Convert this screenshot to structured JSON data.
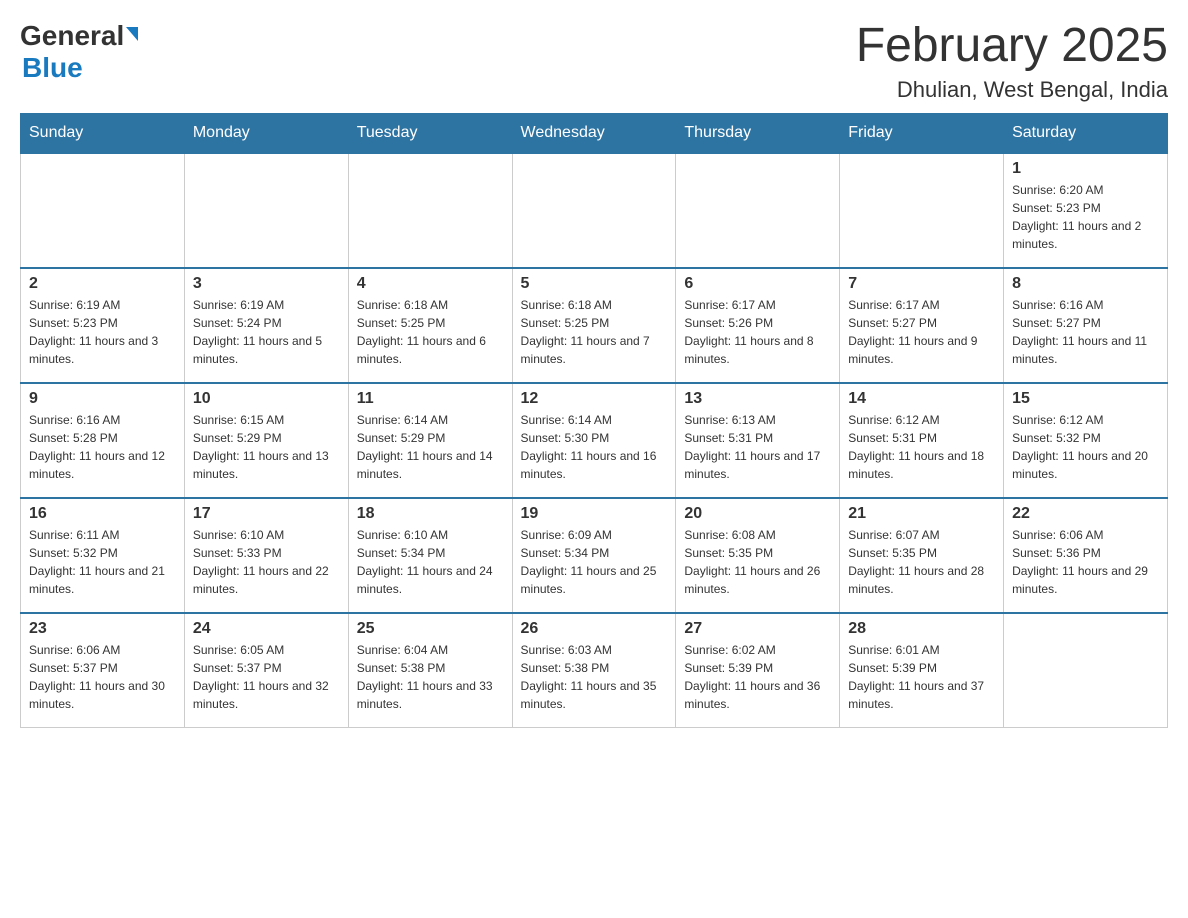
{
  "header": {
    "logo": {
      "general_text": "General",
      "blue_text": "Blue"
    },
    "title": "February 2025",
    "subtitle": "Dhulian, West Bengal, India"
  },
  "days_of_week": [
    "Sunday",
    "Monday",
    "Tuesday",
    "Wednesday",
    "Thursday",
    "Friday",
    "Saturday"
  ],
  "weeks": [
    [
      {
        "day": "",
        "sunrise": "",
        "sunset": "",
        "daylight": ""
      },
      {
        "day": "",
        "sunrise": "",
        "sunset": "",
        "daylight": ""
      },
      {
        "day": "",
        "sunrise": "",
        "sunset": "",
        "daylight": ""
      },
      {
        "day": "",
        "sunrise": "",
        "sunset": "",
        "daylight": ""
      },
      {
        "day": "",
        "sunrise": "",
        "sunset": "",
        "daylight": ""
      },
      {
        "day": "",
        "sunrise": "",
        "sunset": "",
        "daylight": ""
      },
      {
        "day": "1",
        "sunrise": "Sunrise: 6:20 AM",
        "sunset": "Sunset: 5:23 PM",
        "daylight": "Daylight: 11 hours and 2 minutes."
      }
    ],
    [
      {
        "day": "2",
        "sunrise": "Sunrise: 6:19 AM",
        "sunset": "Sunset: 5:23 PM",
        "daylight": "Daylight: 11 hours and 3 minutes."
      },
      {
        "day": "3",
        "sunrise": "Sunrise: 6:19 AM",
        "sunset": "Sunset: 5:24 PM",
        "daylight": "Daylight: 11 hours and 5 minutes."
      },
      {
        "day": "4",
        "sunrise": "Sunrise: 6:18 AM",
        "sunset": "Sunset: 5:25 PM",
        "daylight": "Daylight: 11 hours and 6 minutes."
      },
      {
        "day": "5",
        "sunrise": "Sunrise: 6:18 AM",
        "sunset": "Sunset: 5:25 PM",
        "daylight": "Daylight: 11 hours and 7 minutes."
      },
      {
        "day": "6",
        "sunrise": "Sunrise: 6:17 AM",
        "sunset": "Sunset: 5:26 PM",
        "daylight": "Daylight: 11 hours and 8 minutes."
      },
      {
        "day": "7",
        "sunrise": "Sunrise: 6:17 AM",
        "sunset": "Sunset: 5:27 PM",
        "daylight": "Daylight: 11 hours and 9 minutes."
      },
      {
        "day": "8",
        "sunrise": "Sunrise: 6:16 AM",
        "sunset": "Sunset: 5:27 PM",
        "daylight": "Daylight: 11 hours and 11 minutes."
      }
    ],
    [
      {
        "day": "9",
        "sunrise": "Sunrise: 6:16 AM",
        "sunset": "Sunset: 5:28 PM",
        "daylight": "Daylight: 11 hours and 12 minutes."
      },
      {
        "day": "10",
        "sunrise": "Sunrise: 6:15 AM",
        "sunset": "Sunset: 5:29 PM",
        "daylight": "Daylight: 11 hours and 13 minutes."
      },
      {
        "day": "11",
        "sunrise": "Sunrise: 6:14 AM",
        "sunset": "Sunset: 5:29 PM",
        "daylight": "Daylight: 11 hours and 14 minutes."
      },
      {
        "day": "12",
        "sunrise": "Sunrise: 6:14 AM",
        "sunset": "Sunset: 5:30 PM",
        "daylight": "Daylight: 11 hours and 16 minutes."
      },
      {
        "day": "13",
        "sunrise": "Sunrise: 6:13 AM",
        "sunset": "Sunset: 5:31 PM",
        "daylight": "Daylight: 11 hours and 17 minutes."
      },
      {
        "day": "14",
        "sunrise": "Sunrise: 6:12 AM",
        "sunset": "Sunset: 5:31 PM",
        "daylight": "Daylight: 11 hours and 18 minutes."
      },
      {
        "day": "15",
        "sunrise": "Sunrise: 6:12 AM",
        "sunset": "Sunset: 5:32 PM",
        "daylight": "Daylight: 11 hours and 20 minutes."
      }
    ],
    [
      {
        "day": "16",
        "sunrise": "Sunrise: 6:11 AM",
        "sunset": "Sunset: 5:32 PM",
        "daylight": "Daylight: 11 hours and 21 minutes."
      },
      {
        "day": "17",
        "sunrise": "Sunrise: 6:10 AM",
        "sunset": "Sunset: 5:33 PM",
        "daylight": "Daylight: 11 hours and 22 minutes."
      },
      {
        "day": "18",
        "sunrise": "Sunrise: 6:10 AM",
        "sunset": "Sunset: 5:34 PM",
        "daylight": "Daylight: 11 hours and 24 minutes."
      },
      {
        "day": "19",
        "sunrise": "Sunrise: 6:09 AM",
        "sunset": "Sunset: 5:34 PM",
        "daylight": "Daylight: 11 hours and 25 minutes."
      },
      {
        "day": "20",
        "sunrise": "Sunrise: 6:08 AM",
        "sunset": "Sunset: 5:35 PM",
        "daylight": "Daylight: 11 hours and 26 minutes."
      },
      {
        "day": "21",
        "sunrise": "Sunrise: 6:07 AM",
        "sunset": "Sunset: 5:35 PM",
        "daylight": "Daylight: 11 hours and 28 minutes."
      },
      {
        "day": "22",
        "sunrise": "Sunrise: 6:06 AM",
        "sunset": "Sunset: 5:36 PM",
        "daylight": "Daylight: 11 hours and 29 minutes."
      }
    ],
    [
      {
        "day": "23",
        "sunrise": "Sunrise: 6:06 AM",
        "sunset": "Sunset: 5:37 PM",
        "daylight": "Daylight: 11 hours and 30 minutes."
      },
      {
        "day": "24",
        "sunrise": "Sunrise: 6:05 AM",
        "sunset": "Sunset: 5:37 PM",
        "daylight": "Daylight: 11 hours and 32 minutes."
      },
      {
        "day": "25",
        "sunrise": "Sunrise: 6:04 AM",
        "sunset": "Sunset: 5:38 PM",
        "daylight": "Daylight: 11 hours and 33 minutes."
      },
      {
        "day": "26",
        "sunrise": "Sunrise: 6:03 AM",
        "sunset": "Sunset: 5:38 PM",
        "daylight": "Daylight: 11 hours and 35 minutes."
      },
      {
        "day": "27",
        "sunrise": "Sunrise: 6:02 AM",
        "sunset": "Sunset: 5:39 PM",
        "daylight": "Daylight: 11 hours and 36 minutes."
      },
      {
        "day": "28",
        "sunrise": "Sunrise: 6:01 AM",
        "sunset": "Sunset: 5:39 PM",
        "daylight": "Daylight: 11 hours and 37 minutes."
      },
      {
        "day": "",
        "sunrise": "",
        "sunset": "",
        "daylight": ""
      }
    ]
  ]
}
